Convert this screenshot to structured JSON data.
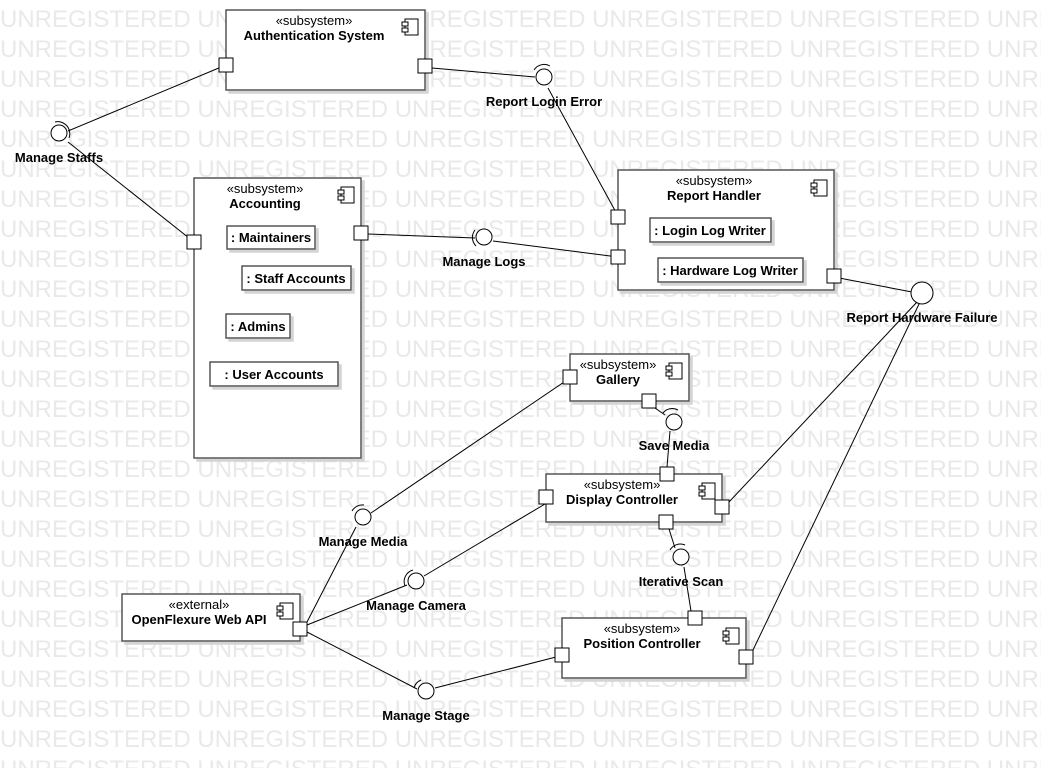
{
  "watermark_text": "UNREGISTERED",
  "components": [
    {
      "id": "auth",
      "stereotype": "«subsystem»",
      "name": "Authentication System"
    },
    {
      "id": "accounting",
      "stereotype": "«subsystem»",
      "name": "Accounting"
    },
    {
      "id": "report",
      "stereotype": "«subsystem»",
      "name": "Report Handler"
    },
    {
      "id": "gallery",
      "stereotype": "«subsystem»",
      "name": "Gallery"
    },
    {
      "id": "display",
      "stereotype": "«subsystem»",
      "name": "Display Controller"
    },
    {
      "id": "position",
      "stereotype": "«subsystem»",
      "name": "Position Controller"
    },
    {
      "id": "ofapi",
      "stereotype": "«external»",
      "name": "OpenFlexure Web API"
    }
  ],
  "parts": [
    {
      "id": "maintainers",
      "label": ": Maintainers"
    },
    {
      "id": "staffaccounts",
      "label": ": Staff Accounts"
    },
    {
      "id": "admins",
      "label": ": Admins"
    },
    {
      "id": "useraccounts",
      "label": ": User Accounts"
    },
    {
      "id": "loginlog",
      "label": ": Login Log Writer"
    },
    {
      "id": "hwlog",
      "label": ": Hardware Log Writer"
    }
  ],
  "interfaces": [
    {
      "id": "managestaffs",
      "label": "Manage Staffs"
    },
    {
      "id": "reportlogin",
      "label": "Report Login Error"
    },
    {
      "id": "managelogs",
      "label": "Manage Logs"
    },
    {
      "id": "reporthw",
      "label": "Report Hardware Failure"
    },
    {
      "id": "savemedia",
      "label": "Save Media"
    },
    {
      "id": "managemedia",
      "label": "Manage Media"
    },
    {
      "id": "iterscan",
      "label": "Iterative Scan"
    },
    {
      "id": "managecamera",
      "label": "Manage Camera"
    },
    {
      "id": "managestage",
      "label": "Manage Stage"
    }
  ]
}
